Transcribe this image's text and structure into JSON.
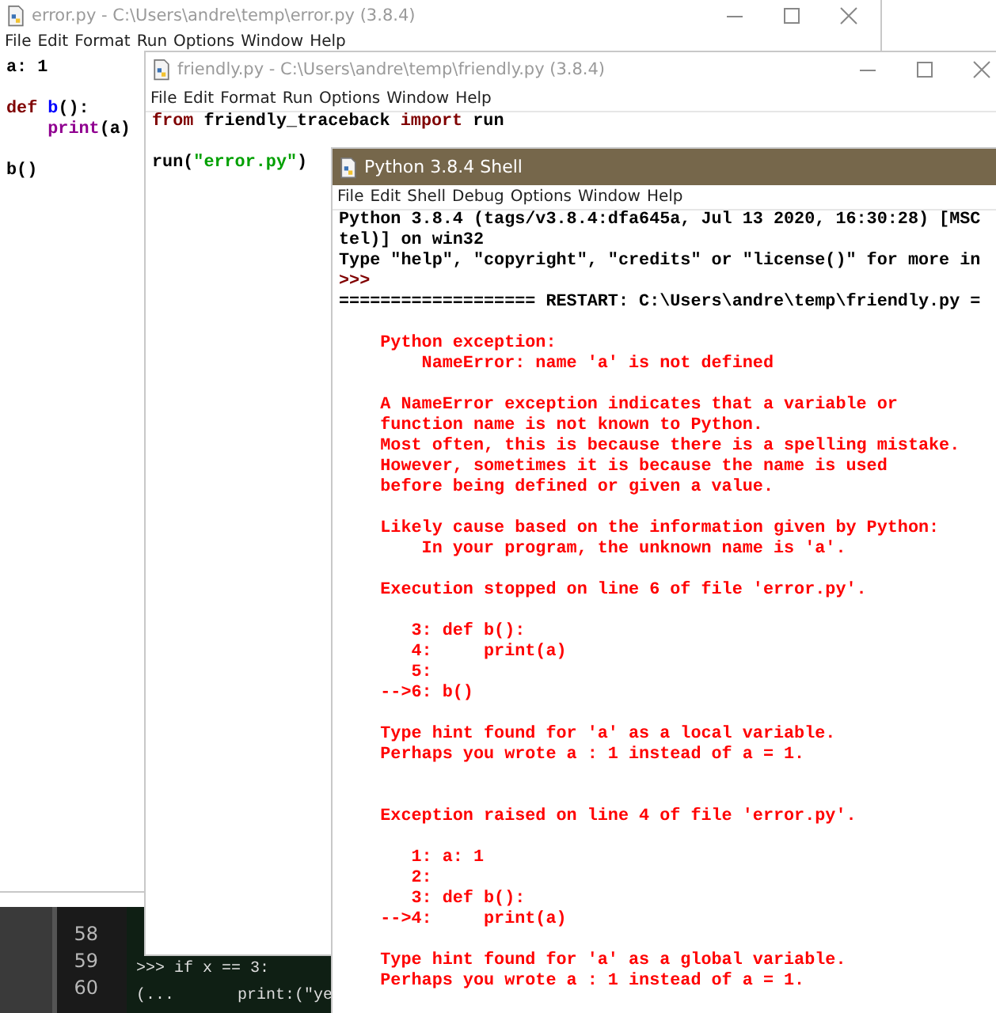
{
  "terminal": {
    "line_numbers": [
      "58",
      "59",
      "60"
    ],
    "lines": [
      {
        "kind": "blank"
      },
      {
        "kind": "code",
        "segments": [
          {
            "text": ">>> if x == 3:"
          }
        ]
      },
      {
        "kind": "code",
        "segments": [
          {
            "text": "(..."
          },
          {
            "text": "print:(\"ye"
          }
        ]
      }
    ]
  },
  "windows": [
    {
      "kind": "editor",
      "active": false,
      "title": "error.py - C:\\Users\\andre\\temp\\error.py (3.8.4)",
      "menu": [
        "File",
        "Edit",
        "Format",
        "Run",
        "Options",
        "Window",
        "Help"
      ],
      "lines": [
        {
          "kind": "code",
          "segments": [
            {
              "text": "a: 1",
              "kind": "plain"
            }
          ]
        },
        {
          "kind": "blank"
        },
        {
          "kind": "code",
          "segments": [
            {
              "text": "def ",
              "kind": "keyword"
            },
            {
              "text": "b",
              "kind": "definition"
            },
            {
              "text": "():",
              "kind": "plain"
            }
          ]
        },
        {
          "kind": "code",
          "segments": [
            {
              "text": "    print",
              "kind": "builtin"
            },
            {
              "text": "(a)",
              "kind": "plain"
            }
          ]
        },
        {
          "kind": "blank"
        },
        {
          "kind": "code",
          "segments": [
            {
              "text": "b()",
              "kind": "plain"
            }
          ]
        }
      ]
    },
    {
      "kind": "editor",
      "active": false,
      "title": "friendly.py - C:\\Users\\andre\\temp\\friendly.py (3.8.4)",
      "menu": [
        "File",
        "Edit",
        "Format",
        "Run",
        "Options",
        "Window",
        "Help"
      ],
      "lines": [
        {
          "kind": "code",
          "segments": [
            {
              "text": "from",
              "kind": "keyword"
            },
            {
              "text": " friendly_traceback ",
              "kind": "plain"
            },
            {
              "text": "import",
              "kind": "keyword"
            },
            {
              "text": " run",
              "kind": "plain"
            }
          ]
        },
        {
          "kind": "blank"
        },
        {
          "kind": "code",
          "segments": [
            {
              "text": "run(",
              "kind": "plain"
            },
            {
              "text": "\"error.py\"",
              "kind": "string"
            },
            {
              "text": ")",
              "kind": "plain"
            }
          ]
        }
      ]
    },
    {
      "kind": "shell",
      "active": true,
      "title": "Python 3.8.4 Shell",
      "menu": [
        "File",
        "Edit",
        "Shell",
        "Debug",
        "Options",
        "Window",
        "Help"
      ],
      "lines": [
        {
          "kind": "stdout",
          "text": "Python 3.8.4 (tags/v3.8.4:dfa645a, Jul 13 2020, 16:30:28) [MSC"
        },
        {
          "kind": "stdout",
          "text": "tel)] on win32"
        },
        {
          "kind": "stdout",
          "text": "Type \"help\", \"copyright\", \"credits\" or \"license()\" for more in"
        },
        {
          "kind": "prompt",
          "text": ">>>"
        },
        {
          "kind": "stdout",
          "text": "=================== RESTART: C:\\Users\\andre\\temp\\friendly.py ="
        },
        {
          "kind": "blank"
        },
        {
          "kind": "error",
          "text": "    Python exception:"
        },
        {
          "kind": "error",
          "text": "        NameError: name 'a' is not defined"
        },
        {
          "kind": "blank"
        },
        {
          "kind": "error",
          "text": "    A NameError exception indicates that a variable or"
        },
        {
          "kind": "error",
          "text": "    function name is not known to Python."
        },
        {
          "kind": "error",
          "text": "    Most often, this is because there is a spelling mistake."
        },
        {
          "kind": "error",
          "text": "    However, sometimes it is because the name is used"
        },
        {
          "kind": "error",
          "text": "    before being defined or given a value."
        },
        {
          "kind": "blank"
        },
        {
          "kind": "error",
          "text": "    Likely cause based on the information given by Python:"
        },
        {
          "kind": "error",
          "text": "        In your program, the unknown name is 'a'."
        },
        {
          "kind": "blank"
        },
        {
          "kind": "error",
          "text": "    Execution stopped on line 6 of file 'error.py'."
        },
        {
          "kind": "blank"
        },
        {
          "kind": "error",
          "text": "       3: def b():"
        },
        {
          "kind": "error",
          "text": "       4:     print(a)"
        },
        {
          "kind": "error",
          "text": "       5:"
        },
        {
          "kind": "error",
          "text": "    -->6: b()"
        },
        {
          "kind": "blank"
        },
        {
          "kind": "error",
          "text": "    Type hint found for 'a' as a local variable."
        },
        {
          "kind": "error",
          "text": "    Perhaps you wrote a : 1 instead of a = 1."
        },
        {
          "kind": "blank"
        },
        {
          "kind": "blank"
        },
        {
          "kind": "error",
          "text": "    Exception raised on line 4 of file 'error.py'."
        },
        {
          "kind": "blank"
        },
        {
          "kind": "error",
          "text": "       1: a: 1"
        },
        {
          "kind": "error",
          "text": "       2:"
        },
        {
          "kind": "error",
          "text": "       3: def b():"
        },
        {
          "kind": "error",
          "text": "    -->4:     print(a)"
        },
        {
          "kind": "blank"
        },
        {
          "kind": "error",
          "text": "    Type hint found for 'a' as a global variable."
        },
        {
          "kind": "error",
          "text": "    Perhaps you wrote a : 1 instead of a = 1."
        }
      ]
    }
  ]
}
